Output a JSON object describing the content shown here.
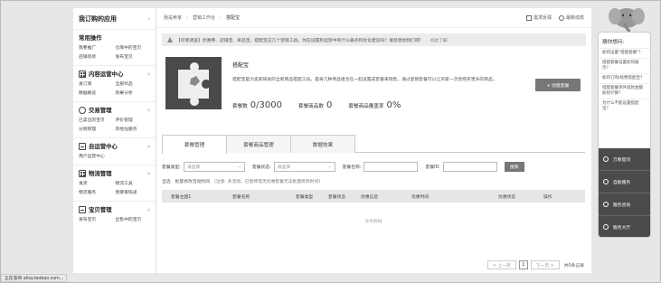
{
  "sidebar": {
    "top_title": "我订购的应用",
    "sections": [
      {
        "title": "常用操作",
        "icon": "",
        "links": [
          "我要推广",
          "仓库中的宝贝",
          "店铺装修",
          "发布宝贝"
        ]
      },
      {
        "title": "内容运营中心",
        "icon": "grid-icon",
        "links": [
          "发订阅",
          "全部作品",
          "数据概览",
          "效果分析"
        ]
      },
      {
        "title": "交易管理",
        "icon": "trade-icon",
        "links": [
          "已卖出的宝贝",
          "评价管理",
          "分销管理",
          "改地址服务"
        ]
      },
      {
        "title": "自运营中心",
        "icon": "self-service-icon",
        "links": [
          "用户运营中心"
        ]
      },
      {
        "title": "物流管理",
        "icon": "logistics-icon",
        "links": [
          "发货",
          "物流工具",
          "物流服务",
          "我要寄快递"
        ]
      },
      {
        "title": "宝贝管理",
        "icon": "goods-icon",
        "links": [
          "发布宝贝",
          "出售中的宝贝"
        ]
      }
    ]
  },
  "topbar": {
    "breadcrumbs": [
      "我是卖家",
      "营销工作台",
      "搭配宝"
    ],
    "actions": {
      "feedback": "需求反馈",
      "latest": "最新动态"
    }
  },
  "notice": {
    "text": "【问卷调查】优惠券、店铺宝、单品宝、搭配宝这几个营销工具，你在设置和运营中有什么痛点和优化建议吗？请反馈给我们吧！",
    "link": "点此了解"
  },
  "product": {
    "name": "搭配宝",
    "description": "搭配宝是为卖家研发的全新商品搭配工具，是将几种商品组合在一起设置成套餐来销售，通过促销套餐可以让买家一次性购买更多的商品。",
    "create_button": "+ 创建套餐",
    "stats": [
      {
        "label": "套餐数",
        "value": "0/3000"
      },
      {
        "label": "套餐商品数",
        "value": "0"
      },
      {
        "label": "套餐商品覆盖率",
        "value": "0%"
      }
    ]
  },
  "tabs": [
    "套餐管理",
    "套餐商品管理",
    "数据效果"
  ],
  "filters": {
    "type_label": "套餐类型:",
    "type_placeholder": "请选择",
    "status_label": "套餐状态:",
    "status_placeholder": "请选择",
    "name_label": "套餐名称:",
    "id_label": "套餐ID:",
    "search_button": "搜索"
  },
  "batch": {
    "select_all": "全选",
    "action": "批量修改活动时间",
    "hint": "(注意: 多活动、已暂停或无优惠套餐无法批量修改时间)"
  },
  "table": {
    "columns": [
      "套餐主图1",
      "套餐名称",
      "套餐类型",
      "套餐状态",
      "优惠信息",
      "优惠时间",
      "优惠状态",
      "操作"
    ],
    "empty_text": "没有数据"
  },
  "pager": {
    "prev": "< 上一页",
    "current": "1",
    "next": "下一页 >",
    "total": "共0条记录"
  },
  "assistant": {
    "title": "猜你想问:",
    "questions": [
      "如何设置\"搭配套餐\"？",
      "搭配套餐设置如何展示？",
      "如何订购/续费搭配宝？",
      "搭配套餐单件退款金额如何计算？",
      "为什么不能设置搭配宝？"
    ],
    "buttons": [
      "万象提问",
      "自助服务",
      "服务咨询",
      "服务大厅"
    ]
  },
  "statusbar": {
    "text": "正在等待 alisy.taobao.com..."
  }
}
